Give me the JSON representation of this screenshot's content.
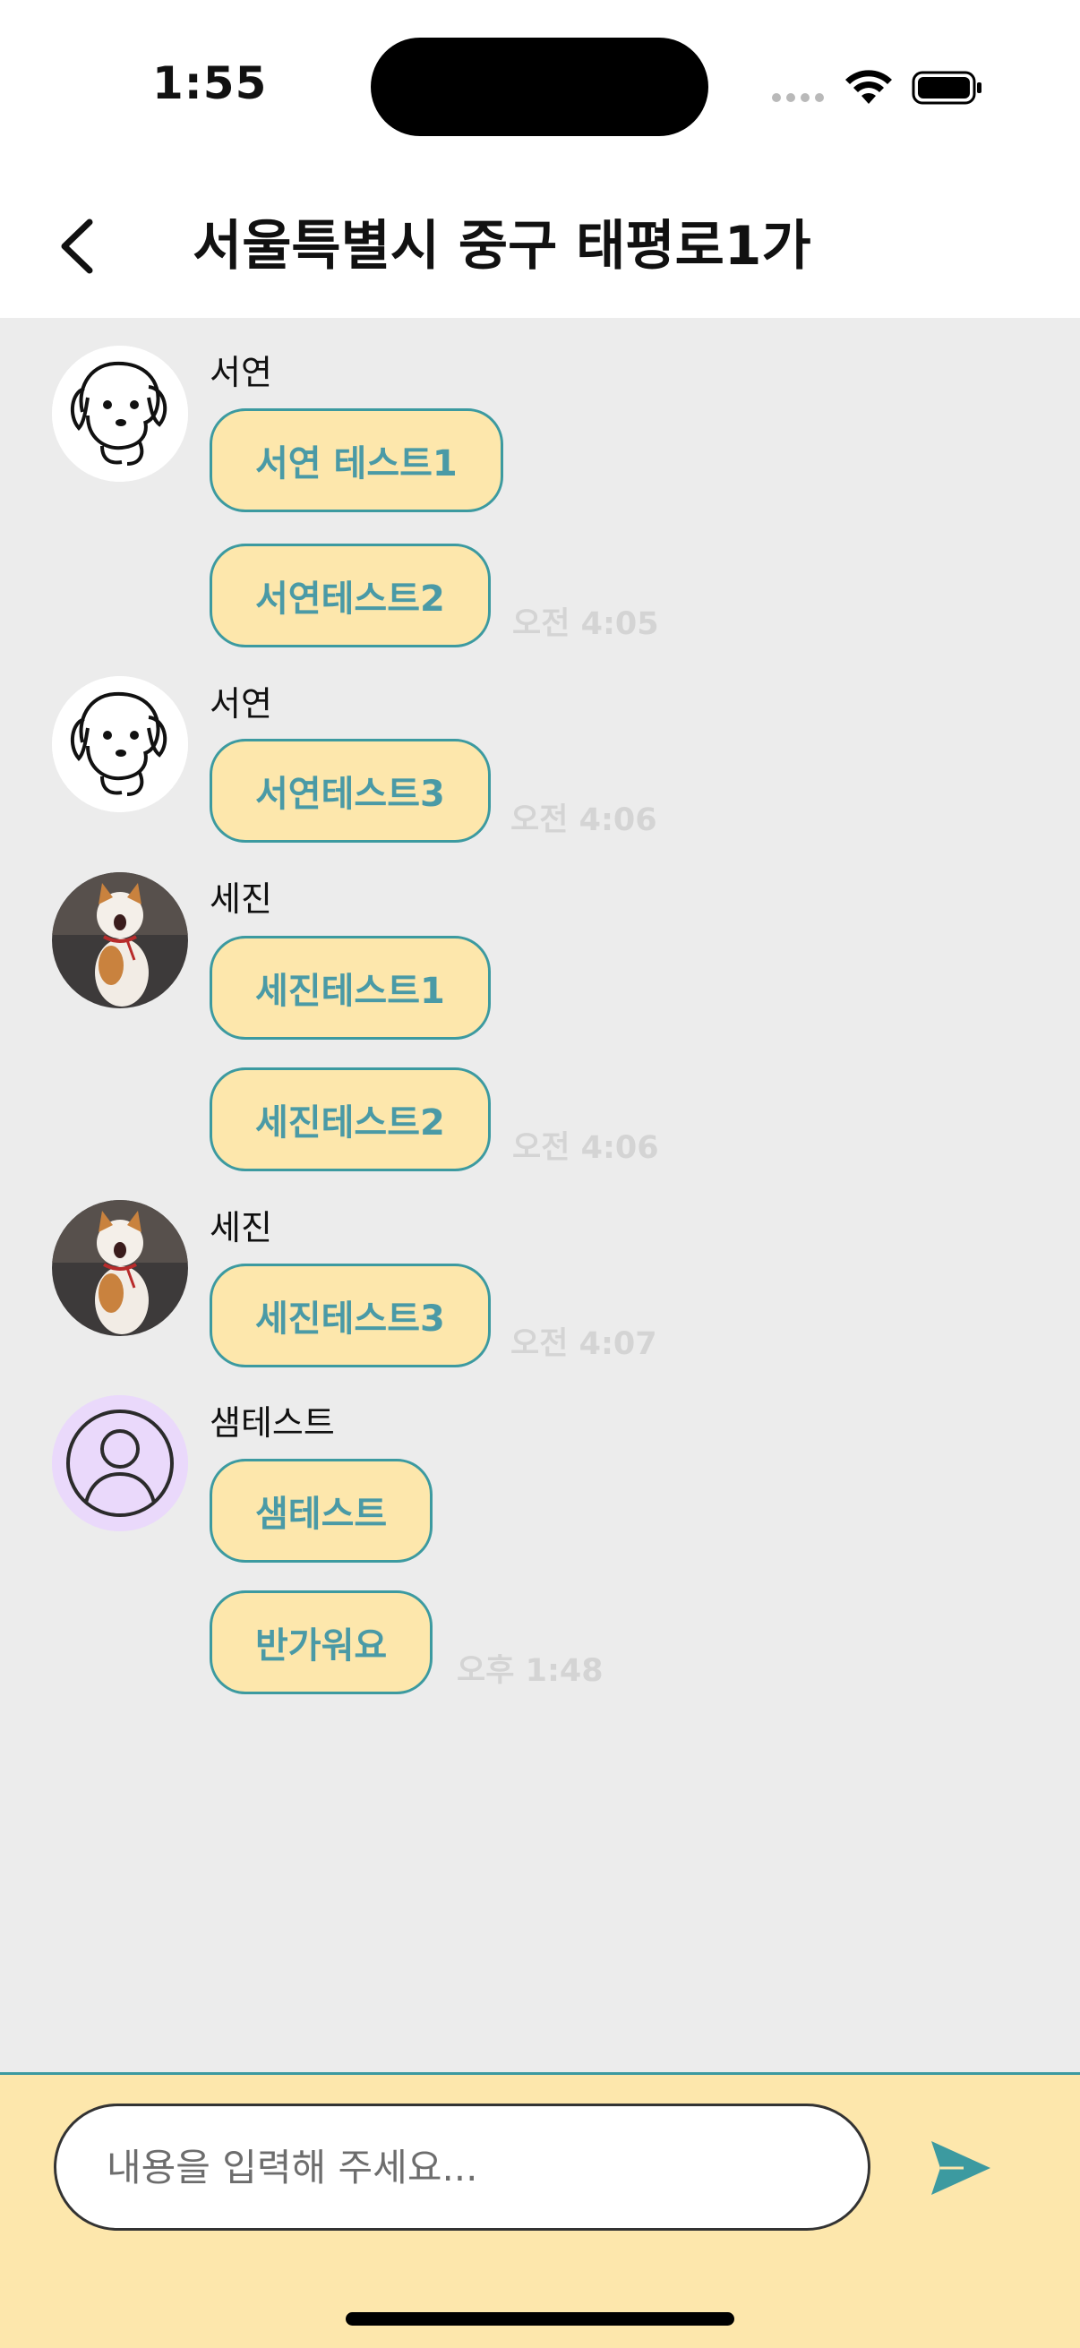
{
  "status_bar": {
    "time": "1:55"
  },
  "header": {
    "title": "서울특별시 중구 태평로1가"
  },
  "messages": [
    {
      "sender": "서연",
      "avatar": "puppy-drawing",
      "bubbles": [
        "서연 테스트1",
        "서연테스트2"
      ],
      "time": "오전 4:05"
    },
    {
      "sender": "서연",
      "avatar": "puppy-drawing",
      "bubbles": [
        "서연테스트3"
      ],
      "time": "오전 4:06"
    },
    {
      "sender": "세진",
      "avatar": "cat-photo",
      "bubbles": [
        "세진테스트1",
        "세진테스트2"
      ],
      "time": "오전 4:06"
    },
    {
      "sender": "세진",
      "avatar": "cat-photo",
      "bubbles": [
        "세진테스트3"
      ],
      "time": "오전 4:07"
    },
    {
      "sender": "샘테스트",
      "avatar": "default-user",
      "bubbles": [
        "샘테스트",
        "반가워요"
      ],
      "time": "오후 1:48"
    }
  ],
  "composer": {
    "placeholder": "내용을 입력해 주세요..."
  },
  "icons": {
    "back": "chevron-left-icon",
    "send": "send-icon",
    "wifi": "wifi-icon",
    "battery": "battery-icon"
  },
  "colors": {
    "bubble_bg": "#fde7ac",
    "bubble_border": "#3c9aa0",
    "bubble_text": "#4a9aa6",
    "chat_bg": "#ececec",
    "composer_bg": "#fde7ac",
    "send_icon": "#3c9aa0",
    "default_avatar_bg": "#ead9fb"
  }
}
